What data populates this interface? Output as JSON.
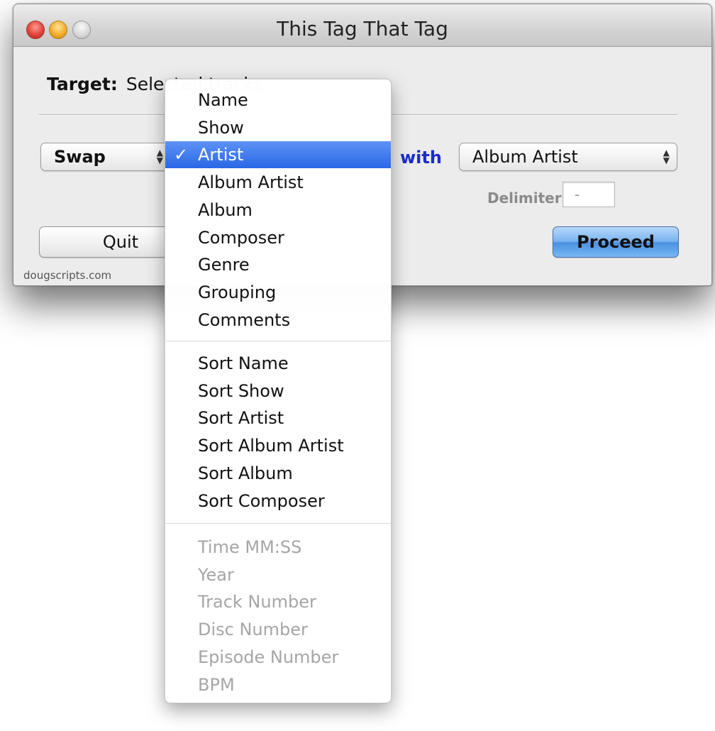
{
  "window": {
    "title": "This Tag That Tag"
  },
  "target": {
    "label": "Target:",
    "value": "Selected tracks"
  },
  "mode_popup": {
    "value": "Swap"
  },
  "with_label": "with",
  "target_popup": {
    "value": "Album Artist"
  },
  "delimiter": {
    "label": "Delimiter:",
    "value": "-"
  },
  "buttons": {
    "quit": "Quit",
    "proceed": "Proceed"
  },
  "footer": {
    "link": "dougscripts.com"
  },
  "menu": {
    "checkmark": "✓",
    "group1": [
      "Name",
      "Show",
      "Artist",
      "Album Artist",
      "Album",
      "Composer",
      "Genre",
      "Grouping",
      "Comments"
    ],
    "group2": [
      "Sort Name",
      "Sort Show",
      "Sort Artist",
      "Sort Album Artist",
      "Sort Album",
      "Sort Composer"
    ],
    "group3": [
      "Time MM:SS",
      "Year",
      "Track Number",
      "Disc Number",
      "Episode Number",
      "BPM"
    ],
    "selected": "Artist",
    "disabled_group": "group3"
  },
  "colors": {
    "accent": "#2a67e6",
    "with_text": "#1c2bd0",
    "disabled_text": "#a6a6a6"
  }
}
